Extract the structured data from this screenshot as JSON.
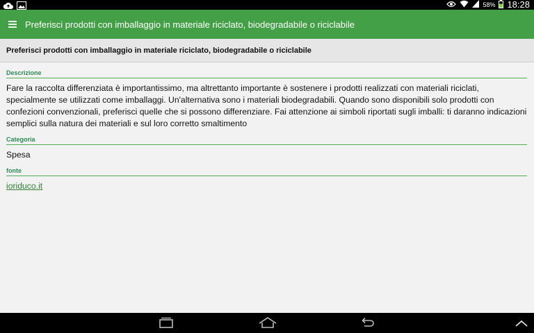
{
  "status_bar": {
    "battery": "58%",
    "time": "18:28",
    "icons": [
      "cloud-upload-icon",
      "image-icon",
      "eye-icon",
      "wifi-icon",
      "signal-icon",
      "battery-icon"
    ]
  },
  "action_bar": {
    "menu_icon": "menu-icon",
    "title": "Preferisci prodotti con imballaggio in materiale riciclato, biodegradabile o riciclabile"
  },
  "header": {
    "title": "Preferisci prodotti con imballaggio in materiale riciclato, biodegradabile o riciclabile"
  },
  "sections": {
    "description": {
      "label": "Descrizione",
      "text": "Fare la raccolta differenziata è importantissimo, ma altrettanto importante è sostenere i prodotti realizzati con materiali riciclati, specialmente se utilizzati come imballaggi. Un'alternativa sono i materiali biodegradabili. Quando sono disponibili solo prodotti con confezioni convenzionali, preferisci quelle che si possono differenziare. Fai attenzione ai simboli riportati sugli imballi: ti daranno indicazioni semplici sulla natura dei materiali e sul loro corretto smaltimento"
    },
    "category": {
      "label": "Categoria",
      "text": "Spesa"
    },
    "source": {
      "label": "fonte",
      "link": "ioriduco.it"
    }
  },
  "nav_bar": {
    "icons": [
      "recent-apps-icon",
      "home-icon",
      "back-icon",
      "chevron-up-icon"
    ]
  },
  "colors": {
    "accent": "#43a047",
    "label": "#2e8b57"
  }
}
